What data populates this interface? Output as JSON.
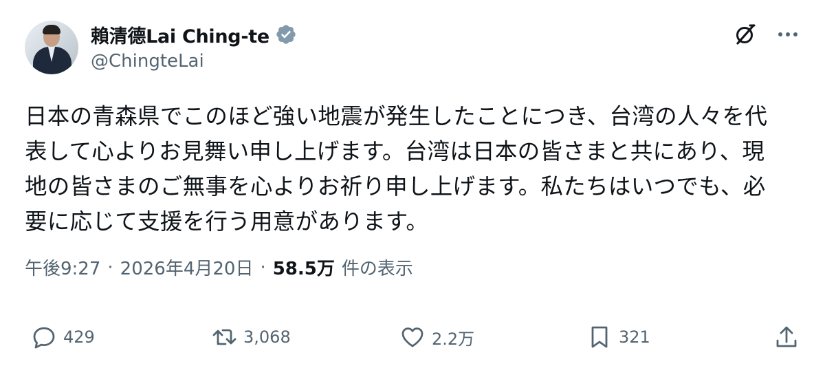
{
  "author": {
    "display_name": "賴清德Lai Ching-te",
    "handle": "@ChingteLai",
    "verified_badge_color": "#829aab"
  },
  "tweet": {
    "text": "日本の青森県でこのほど強い地震が発生したことにつき、台湾の人々を代\n表して心よりお見舞い申し上げます。台湾は日本の皆さまと共にあり、現\n地の皆さまのご無事を心よりお祈り申し上げます。私たちはいつでも、必\n要に応じて支援を行う用意があります。",
    "time": "午後9:27",
    "separator": "·",
    "date": "2026年4月20日",
    "views_count": "58.5万",
    "views_suffix": "件の表示"
  },
  "actions": {
    "replies": "429",
    "reposts": "3,068",
    "likes": "2.2万",
    "bookmarks": "321"
  },
  "icons": {
    "top_right": [
      "grok-icon",
      "more-icon"
    ],
    "action_bar": [
      "reply-icon",
      "repost-icon",
      "like-icon",
      "bookmark-icon",
      "share-icon"
    ]
  },
  "colors": {
    "text_primary": "#0f1419",
    "text_secondary": "#536471",
    "background": "#ffffff"
  }
}
